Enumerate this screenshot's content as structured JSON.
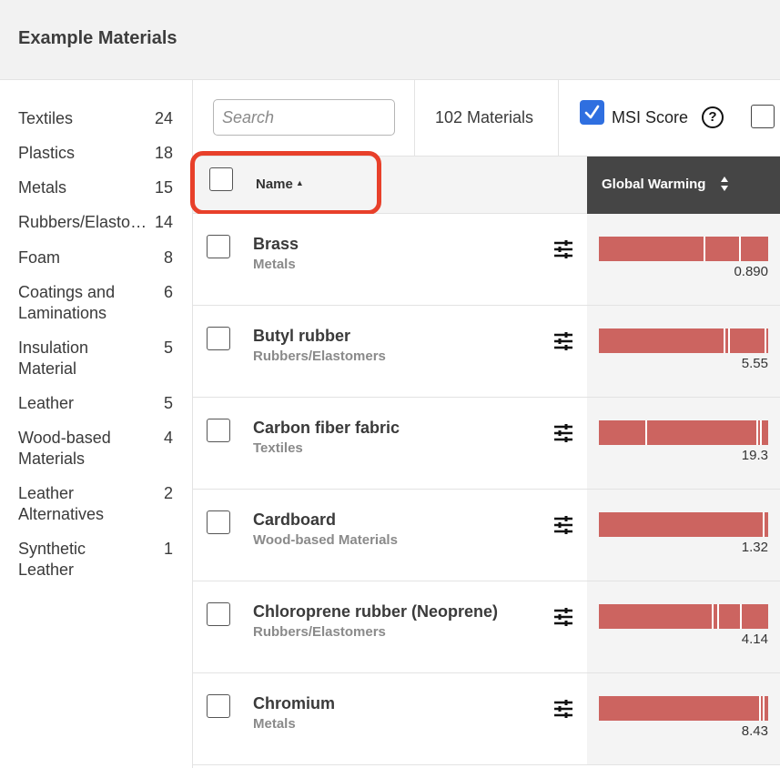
{
  "header": {
    "title": "Example Materials"
  },
  "sidebar": {
    "categories": [
      {
        "label": "Textiles",
        "count": "24"
      },
      {
        "label": "Plastics",
        "count": "18"
      },
      {
        "label": "Metals",
        "count": "15"
      },
      {
        "label": "Rubbers/Elastomers",
        "count": "14"
      },
      {
        "label": "Foam",
        "count": "8"
      },
      {
        "label": "Coatings and Laminations",
        "count": "6"
      },
      {
        "label": "Insulation Material",
        "count": "5"
      },
      {
        "label": "Leather",
        "count": "5"
      },
      {
        "label": "Wood-based Materials",
        "count": "4"
      },
      {
        "label": "Leather Alternatives",
        "count": "2"
      },
      {
        "label": "Synthetic Leather",
        "count": "1"
      }
    ]
  },
  "toolbar": {
    "search_placeholder": "Search",
    "material_count": "102 Materials",
    "msi_label": "MSI Score",
    "help_glyph": "?"
  },
  "table": {
    "name_header": "Name",
    "sort_glyph": "▲",
    "gw_header": "Global Warming",
    "rows": [
      {
        "name": "Brass",
        "category": "Metals",
        "value": "0.890"
      },
      {
        "name": "Butyl rubber",
        "category": "Rubbers/Elastomers",
        "value": "5.55"
      },
      {
        "name": "Carbon fiber fabric",
        "category": "Textiles",
        "value": "19.3"
      },
      {
        "name": "Cardboard",
        "category": "Wood-based Materials",
        "value": "1.32"
      },
      {
        "name": "Chloroprene rubber (Neoprene)",
        "category": "Rubbers/Elastomers",
        "value": "4.14"
      },
      {
        "name": "Chromium",
        "category": "Metals",
        "value": "8.43"
      }
    ]
  },
  "colors": {
    "accent": "#2f6fe0",
    "bar": "#cc6460",
    "highlight": "#e8402a",
    "header_dark": "#454545"
  }
}
